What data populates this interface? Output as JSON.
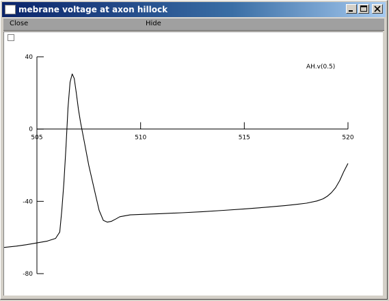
{
  "window": {
    "title": "mebrane voltage at axon hillock"
  },
  "menu": {
    "close_label": "Close",
    "hide_label": "Hide"
  },
  "chart_data": {
    "type": "line",
    "title": "",
    "xlabel": "",
    "ylabel": "",
    "xlim": [
      505,
      520
    ],
    "ylim": [
      -80,
      40
    ],
    "x_ticks": [
      505,
      510,
      515,
      520
    ],
    "y_ticks": [
      40,
      0,
      -40,
      -80
    ],
    "x_tick_labels": [
      "505",
      "510",
      "515",
      "520"
    ],
    "y_tick_labels": [
      "40",
      "0",
      "-40",
      "-80"
    ],
    "grid": false,
    "series": [
      {
        "name": "AH.v(0.5)",
        "color": "#000000",
        "x": [
          503.4,
          504.0,
          504.5,
          505.0,
          505.5,
          505.9,
          506.1,
          506.2,
          506.3,
          506.4,
          506.5,
          506.6,
          506.7,
          506.8,
          506.9,
          507.0,
          507.1,
          507.3,
          507.5,
          507.8,
          508.0,
          508.2,
          508.4,
          508.6,
          508.8,
          509.0,
          509.5,
          510.0,
          511.0,
          512.0,
          513.0,
          514.0,
          515.0,
          516.0,
          517.0,
          517.5,
          518.0,
          518.5,
          518.8,
          519.0,
          519.2,
          519.4,
          519.6,
          519.8,
          520.0
        ],
        "y": [
          -65.5,
          -64.8,
          -64.0,
          -63.0,
          -62.0,
          -60.5,
          -57.0,
          -45.0,
          -30.0,
          -10.0,
          12.0,
          26.0,
          30.5,
          28.0,
          20.0,
          11.0,
          4.0,
          -8.0,
          -20.0,
          -35.0,
          -45.0,
          -50.5,
          -51.5,
          -51.0,
          -49.8,
          -48.5,
          -47.5,
          -47.2,
          -46.8,
          -46.3,
          -45.7,
          -45.0,
          -44.2,
          -43.3,
          -42.3,
          -41.7,
          -41.0,
          -39.8,
          -38.6,
          -37.2,
          -35.2,
          -32.5,
          -28.5,
          -23.5,
          -19.0
        ]
      }
    ],
    "legend": "top-right"
  }
}
